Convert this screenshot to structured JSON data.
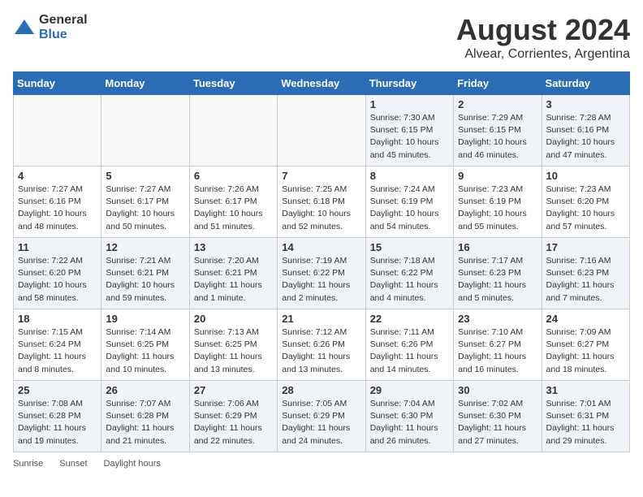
{
  "logo": {
    "general": "General",
    "blue": "Blue"
  },
  "title": "August 2024",
  "subtitle": "Alvear, Corrientes, Argentina",
  "days_of_week": [
    "Sunday",
    "Monday",
    "Tuesday",
    "Wednesday",
    "Thursday",
    "Friday",
    "Saturday"
  ],
  "weeks": [
    [
      {
        "day": "",
        "info": ""
      },
      {
        "day": "",
        "info": ""
      },
      {
        "day": "",
        "info": ""
      },
      {
        "day": "",
        "info": ""
      },
      {
        "day": "1",
        "sunrise": "7:30 AM",
        "sunset": "6:15 PM",
        "daylight": "10 hours and 45 minutes."
      },
      {
        "day": "2",
        "sunrise": "7:29 AM",
        "sunset": "6:15 PM",
        "daylight": "10 hours and 46 minutes."
      },
      {
        "day": "3",
        "sunrise": "7:28 AM",
        "sunset": "6:16 PM",
        "daylight": "10 hours and 47 minutes."
      }
    ],
    [
      {
        "day": "4",
        "sunrise": "7:27 AM",
        "sunset": "6:16 PM",
        "daylight": "10 hours and 48 minutes."
      },
      {
        "day": "5",
        "sunrise": "7:27 AM",
        "sunset": "6:17 PM",
        "daylight": "10 hours and 50 minutes."
      },
      {
        "day": "6",
        "sunrise": "7:26 AM",
        "sunset": "6:17 PM",
        "daylight": "10 hours and 51 minutes."
      },
      {
        "day": "7",
        "sunrise": "7:25 AM",
        "sunset": "6:18 PM",
        "daylight": "10 hours and 52 minutes."
      },
      {
        "day": "8",
        "sunrise": "7:24 AM",
        "sunset": "6:19 PM",
        "daylight": "10 hours and 54 minutes."
      },
      {
        "day": "9",
        "sunrise": "7:23 AM",
        "sunset": "6:19 PM",
        "daylight": "10 hours and 55 minutes."
      },
      {
        "day": "10",
        "sunrise": "7:23 AM",
        "sunset": "6:20 PM",
        "daylight": "10 hours and 57 minutes."
      }
    ],
    [
      {
        "day": "11",
        "sunrise": "7:22 AM",
        "sunset": "6:20 PM",
        "daylight": "10 hours and 58 minutes."
      },
      {
        "day": "12",
        "sunrise": "7:21 AM",
        "sunset": "6:21 PM",
        "daylight": "10 hours and 59 minutes."
      },
      {
        "day": "13",
        "sunrise": "7:20 AM",
        "sunset": "6:21 PM",
        "daylight": "11 hours and 1 minute."
      },
      {
        "day": "14",
        "sunrise": "7:19 AM",
        "sunset": "6:22 PM",
        "daylight": "11 hours and 2 minutes."
      },
      {
        "day": "15",
        "sunrise": "7:18 AM",
        "sunset": "6:22 PM",
        "daylight": "11 hours and 4 minutes."
      },
      {
        "day": "16",
        "sunrise": "7:17 AM",
        "sunset": "6:23 PM",
        "daylight": "11 hours and 5 minutes."
      },
      {
        "day": "17",
        "sunrise": "7:16 AM",
        "sunset": "6:23 PM",
        "daylight": "11 hours and 7 minutes."
      }
    ],
    [
      {
        "day": "18",
        "sunrise": "7:15 AM",
        "sunset": "6:24 PM",
        "daylight": "11 hours and 8 minutes."
      },
      {
        "day": "19",
        "sunrise": "7:14 AM",
        "sunset": "6:25 PM",
        "daylight": "11 hours and 10 minutes."
      },
      {
        "day": "20",
        "sunrise": "7:13 AM",
        "sunset": "6:25 PM",
        "daylight": "11 hours and 13 minutes."
      },
      {
        "day": "21",
        "sunrise": "7:12 AM",
        "sunset": "6:26 PM",
        "daylight": "11 hours and 13 minutes."
      },
      {
        "day": "22",
        "sunrise": "7:11 AM",
        "sunset": "6:26 PM",
        "daylight": "11 hours and 14 minutes."
      },
      {
        "day": "23",
        "sunrise": "7:10 AM",
        "sunset": "6:27 PM",
        "daylight": "11 hours and 16 minutes."
      },
      {
        "day": "24",
        "sunrise": "7:09 AM",
        "sunset": "6:27 PM",
        "daylight": "11 hours and 18 minutes."
      }
    ],
    [
      {
        "day": "25",
        "sunrise": "7:08 AM",
        "sunset": "6:28 PM",
        "daylight": "11 hours and 19 minutes."
      },
      {
        "day": "26",
        "sunrise": "7:07 AM",
        "sunset": "6:28 PM",
        "daylight": "11 hours and 21 minutes."
      },
      {
        "day": "27",
        "sunrise": "7:06 AM",
        "sunset": "6:29 PM",
        "daylight": "11 hours and 22 minutes."
      },
      {
        "day": "28",
        "sunrise": "7:05 AM",
        "sunset": "6:29 PM",
        "daylight": "11 hours and 24 minutes."
      },
      {
        "day": "29",
        "sunrise": "7:04 AM",
        "sunset": "6:30 PM",
        "daylight": "11 hours and 26 minutes."
      },
      {
        "day": "30",
        "sunrise": "7:02 AM",
        "sunset": "6:30 PM",
        "daylight": "11 hours and 27 minutes."
      },
      {
        "day": "31",
        "sunrise": "7:01 AM",
        "sunset": "6:31 PM",
        "daylight": "11 hours and 29 minutes."
      }
    ]
  ],
  "legend": {
    "sunrise": "Sunrise",
    "sunset": "Sunset",
    "daylight": "Daylight hours"
  }
}
